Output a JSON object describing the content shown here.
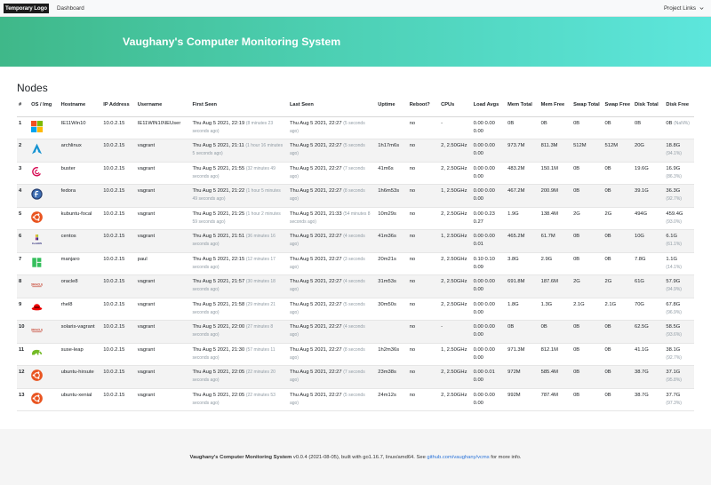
{
  "navbar": {
    "logo": "Temporary Logo",
    "dashboard": "Dashboard",
    "project_links": "Project Links"
  },
  "hero": {
    "title": "Vaughany's Computer Monitoring System"
  },
  "nodes": {
    "title": "Nodes",
    "headers": [
      "#",
      "OS / Img",
      "Hostname",
      "IP Address",
      "Username",
      "First Seen",
      "Last Seen",
      "Uptime",
      "Reboot?",
      "CPUs",
      "Load Avgs",
      "Mem Total",
      "Mem Free",
      "Swap Total",
      "Swap Free",
      "Disk Total",
      "Disk Free"
    ],
    "rows": [
      {
        "num": "1",
        "os": "windows",
        "host": "IE11Win10",
        "ip": "10.0.2.15",
        "user": "IE11WIN10\\IEUser",
        "first": "Thu Aug 5 2021, 22:19",
        "first_ago": "(8 minutes 23 seconds ago)",
        "last": "Thu Aug 5 2021, 22:27",
        "last_ago": "(5 seconds ago)",
        "uptime": "",
        "reboot": "no",
        "cpus": "-",
        "load": "0.00 0.00 0.00",
        "memtotal": "0B",
        "memfree": "0B",
        "swaptotal": "0B",
        "swapfree": "0B",
        "disktotal": "0B",
        "diskfree": "0B",
        "diskfree_pct": "(NaN%)"
      },
      {
        "num": "2",
        "os": "arch",
        "host": "archlinux",
        "ip": "10.0.2.15",
        "user": "vagrant",
        "first": "Thu Aug 5 2021, 21:11",
        "first_ago": "(1 hour 16 minutes 5 seconds ago)",
        "last": "Thu Aug 5 2021, 22:27",
        "last_ago": "(5 seconds ago)",
        "uptime": "1h17m6s",
        "reboot": "no",
        "cpus": "2, 2.50GHz",
        "load": "0.00 0.00 0.00",
        "memtotal": "973.7M",
        "memfree": "811.3M",
        "swaptotal": "512M",
        "swapfree": "512M",
        "disktotal": "20G",
        "diskfree": "18.8G",
        "diskfree_pct": "(94.1%)"
      },
      {
        "num": "3",
        "os": "debian",
        "host": "buster",
        "ip": "10.0.2.15",
        "user": "vagrant",
        "first": "Thu Aug 5 2021, 21:55",
        "first_ago": "(32 minutes 49 seconds ago)",
        "last": "Thu Aug 5 2021, 22:27",
        "last_ago": "(7 seconds ago)",
        "uptime": "41m6s",
        "reboot": "no",
        "cpus": "2, 2.50GHz",
        "load": "0.00 0.00 0.00",
        "memtotal": "483.2M",
        "memfree": "150.1M",
        "swaptotal": "0B",
        "swapfree": "0B",
        "disktotal": "19.6G",
        "diskfree": "16.9G",
        "diskfree_pct": "(86.3%)"
      },
      {
        "num": "4",
        "os": "fedora",
        "host": "fedora",
        "ip": "10.0.2.15",
        "user": "vagrant",
        "first": "Thu Aug 5 2021, 21:22",
        "first_ago": "(1 hour 5 minutes 49 seconds ago)",
        "last": "Thu Aug 5 2021, 22:27",
        "last_ago": "(8 seconds ago)",
        "uptime": "1h6m53s",
        "reboot": "no",
        "cpus": "1, 2.50GHz",
        "load": "0.00 0.00 0.00",
        "memtotal": "467.2M",
        "memfree": "200.9M",
        "swaptotal": "0B",
        "swapfree": "0B",
        "disktotal": "39.1G",
        "diskfree": "36.3G",
        "diskfree_pct": "(92.7%)"
      },
      {
        "num": "5",
        "os": "ubuntu",
        "host": "kubuntu-focal",
        "ip": "10.0.2.15",
        "user": "vagrant",
        "first": "Thu Aug 5 2021, 21:25",
        "first_ago": "(1 hour 2 minutes 59 seconds ago)",
        "last": "Thu Aug 5 2021, 21:33",
        "last_ago": "(54 minutes 8 seconds ago)",
        "uptime": "10m29s",
        "reboot": "no",
        "cpus": "2, 2.50GHz",
        "load": "0.00 0.23 0.27",
        "memtotal": "1.9G",
        "memfree": "138.4M",
        "swaptotal": "2G",
        "swapfree": "2G",
        "disktotal": "494G",
        "diskfree": "459.4G",
        "diskfree_pct": "(93.0%)"
      },
      {
        "num": "6",
        "os": "centos",
        "host": "centos",
        "ip": "10.0.2.15",
        "user": "vagrant",
        "first": "Thu Aug 5 2021, 21:51",
        "first_ago": "(36 minutes 16 seconds ago)",
        "last": "Thu Aug 5 2021, 22:27",
        "last_ago": "(4 seconds ago)",
        "uptime": "41m36s",
        "reboot": "no",
        "cpus": "1, 2.50GHz",
        "load": "0.00 0.00 0.01",
        "memtotal": "465.2M",
        "memfree": "61.7M",
        "swaptotal": "0B",
        "swapfree": "0B",
        "disktotal": "10G",
        "diskfree": "6.1G",
        "diskfree_pct": "(61.1%)"
      },
      {
        "num": "7",
        "os": "manjaro",
        "host": "manjaro",
        "ip": "10.0.2.15",
        "user": "paul",
        "first": "Thu Aug 5 2021, 22:15",
        "first_ago": "(12 minutes 17 seconds ago)",
        "last": "Thu Aug 5 2021, 22:27",
        "last_ago": "(3 seconds ago)",
        "uptime": "20m21s",
        "reboot": "no",
        "cpus": "2, 2.50GHz",
        "load": "0.10 0.10 0.09",
        "memtotal": "3.8G",
        "memfree": "2.9G",
        "swaptotal": "0B",
        "swapfree": "0B",
        "disktotal": "7.8G",
        "diskfree": "1.1G",
        "diskfree_pct": "(14.1%)"
      },
      {
        "num": "8",
        "os": "oracle",
        "host": "oracle8",
        "ip": "10.0.2.15",
        "user": "vagrant",
        "first": "Thu Aug 5 2021, 21:57",
        "first_ago": "(30 minutes 18 seconds ago)",
        "last": "Thu Aug 5 2021, 22:27",
        "last_ago": "(4 seconds ago)",
        "uptime": "31m53s",
        "reboot": "no",
        "cpus": "2, 2.50GHz",
        "load": "0.00 0.00 0.00",
        "memtotal": "691.8M",
        "memfree": "187.6M",
        "swaptotal": "2G",
        "swapfree": "2G",
        "disktotal": "61G",
        "diskfree": "57.9G",
        "diskfree_pct": "(94.9%)"
      },
      {
        "num": "9",
        "os": "redhat",
        "host": "rhel8",
        "ip": "10.0.2.15",
        "user": "vagrant",
        "first": "Thu Aug 5 2021, 21:58",
        "first_ago": "(29 minutes 21 seconds ago)",
        "last": "Thu Aug 5 2021, 22:27",
        "last_ago": "(5 seconds ago)",
        "uptime": "30m50s",
        "reboot": "no",
        "cpus": "2, 2.50GHz",
        "load": "0.00 0.00 0.00",
        "memtotal": "1.8G",
        "memfree": "1.3G",
        "swaptotal": "2.1G",
        "swapfree": "2.1G",
        "disktotal": "70G",
        "diskfree": "67.8G",
        "diskfree_pct": "(96.9%)"
      },
      {
        "num": "10",
        "os": "oracle",
        "host": "solaris-vagrant",
        "ip": "10.0.2.15",
        "user": "vagrant",
        "first": "Thu Aug 5 2021, 22:00",
        "first_ago": "(27 minutes 8 seconds ago)",
        "last": "Thu Aug 5 2021, 22:27",
        "last_ago": "(4 seconds ago)",
        "uptime": "",
        "reboot": "no",
        "cpus": "-",
        "load": "0.00 0.00 0.00",
        "memtotal": "0B",
        "memfree": "0B",
        "swaptotal": "0B",
        "swapfree": "0B",
        "disktotal": "62.5G",
        "diskfree": "58.5G",
        "diskfree_pct": "(93.6%)"
      },
      {
        "num": "11",
        "os": "suse",
        "host": "suse-leap",
        "ip": "10.0.2.15",
        "user": "vagrant",
        "first": "Thu Aug 5 2021, 21:30",
        "first_ago": "(57 minutes 11 seconds ago)",
        "last": "Thu Aug 5 2021, 22:27",
        "last_ago": "(8 seconds ago)",
        "uptime": "1h2m36s",
        "reboot": "no",
        "cpus": "1, 2.50GHz",
        "load": "0.00 0.00 0.00",
        "memtotal": "971.3M",
        "memfree": "812.1M",
        "swaptotal": "0B",
        "swapfree": "0B",
        "disktotal": "41.1G",
        "diskfree": "38.1G",
        "diskfree_pct": "(92.7%)"
      },
      {
        "num": "12",
        "os": "ubuntu",
        "host": "ubuntu-hirsute",
        "ip": "10.0.2.15",
        "user": "vagrant",
        "first": "Thu Aug 5 2021, 22:05",
        "first_ago": "(22 minutes 20 seconds ago)",
        "last": "Thu Aug 5 2021, 22:27",
        "last_ago": "(7 seconds ago)",
        "uptime": "23m38s",
        "reboot": "no",
        "cpus": "2, 2.50GHz",
        "load": "0.00 0.01 0.00",
        "memtotal": "972M",
        "memfree": "585.4M",
        "swaptotal": "0B",
        "swapfree": "0B",
        "disktotal": "38.7G",
        "diskfree": "37.1G",
        "diskfree_pct": "(95.8%)"
      },
      {
        "num": "13",
        "os": "ubuntu",
        "host": "ubuntu-xenial",
        "ip": "10.0.2.15",
        "user": "vagrant",
        "first": "Thu Aug 5 2021, 22:05",
        "first_ago": "(22 minutes 53 seconds ago)",
        "last": "Thu Aug 5 2021, 22:27",
        "last_ago": "(5 seconds ago)",
        "uptime": "24m12s",
        "reboot": "no",
        "cpus": "2, 2.50GHz",
        "load": "0.00 0.00 0.00",
        "memtotal": "992M",
        "memfree": "787.4M",
        "swaptotal": "0B",
        "swapfree": "0B",
        "disktotal": "38.7G",
        "diskfree": "37.7G",
        "diskfree_pct": "(97.3%)"
      }
    ]
  },
  "footer": {
    "app_name": "Vaughany's Computer Monitoring System",
    "version_text": " v0.0.4 (2021-08-05), built with go1.16.7, linux/amd64. See ",
    "link": "github.com/vaughany/vcms",
    "suffix": " for more info."
  },
  "os_labels": {
    "centos": "CentOS",
    "oracle": "ORACLE"
  },
  "colors": {
    "gradient_start": "#3fb889",
    "gradient_end": "#5de6dc",
    "link": "#2a73d8",
    "ubuntu": "#e95420",
    "arch": "#1793d1",
    "debian": "#d70a53",
    "fedora": "#294172",
    "manjaro": "#35bf5c",
    "oracle": "#c74634",
    "redhat": "#ee0000",
    "suse": "#73ba25"
  }
}
